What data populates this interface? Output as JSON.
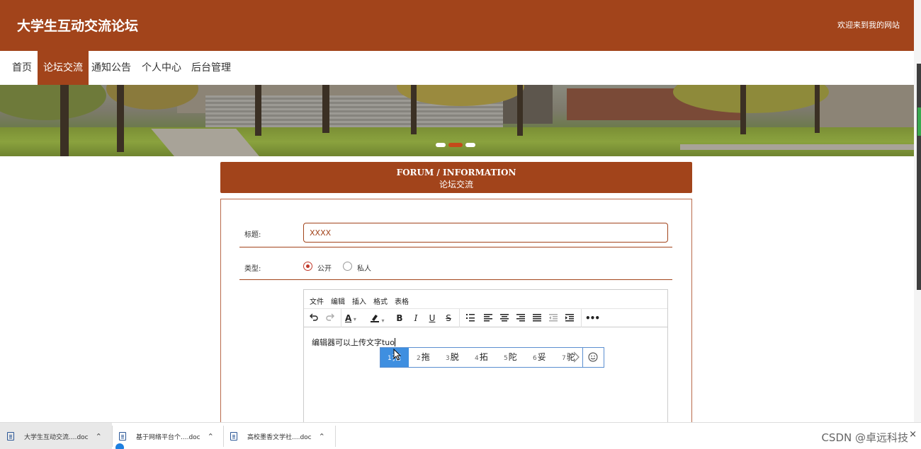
{
  "header": {
    "site_title": "大学生互动交流论坛",
    "welcome": "欢迎来到我的网站"
  },
  "nav": {
    "items": [
      {
        "label": "首页",
        "active": false
      },
      {
        "label": "论坛交流",
        "active": true
      },
      {
        "label": "通知公告",
        "active": false
      },
      {
        "label": "个人中心",
        "active": false
      },
      {
        "label": "后台管理",
        "active": false
      }
    ]
  },
  "banner": {
    "slide_count": 3,
    "active_slide": 2
  },
  "section": {
    "title_en": "FORUM / INFORMATION",
    "title_cn": "论坛交流"
  },
  "form": {
    "title_label": "标题:",
    "title_value": "XXXX",
    "type_label": "类型:",
    "type_options": [
      {
        "label": "公开",
        "checked": true
      },
      {
        "label": "私人",
        "checked": false
      }
    ]
  },
  "editor": {
    "menus": [
      "文件",
      "编辑",
      "插入",
      "格式",
      "表格"
    ],
    "toolbar_icons": [
      "undo-icon",
      "redo-icon",
      "text-color-icon",
      "highlight-icon",
      "bold-icon",
      "italic-icon",
      "underline-icon",
      "strikethrough-icon",
      "numbered-list-icon",
      "align-left-icon",
      "align-center-icon",
      "align-right-icon",
      "justify-icon",
      "outdent-icon",
      "indent-icon",
      "more-icon"
    ],
    "content": "编辑器可以上传文字tuo"
  },
  "ime": {
    "candidates": [
      {
        "num": "1",
        "text": "拖",
        "selected": true
      },
      {
        "num": "2",
        "text": "拖",
        "selected": false
      },
      {
        "num": "3",
        "text": "脱",
        "selected": false
      },
      {
        "num": "4",
        "text": "拓",
        "selected": false
      },
      {
        "num": "5",
        "text": "陀",
        "selected": false
      },
      {
        "num": "6",
        "text": "妥",
        "selected": false
      },
      {
        "num": "7",
        "text": "驼",
        "selected": false
      }
    ],
    "emoji_icon": "smiley-icon",
    "next_icon": "chevron-right-icon"
  },
  "taskbar": {
    "items": [
      {
        "label": "大学生互动交流....doc",
        "active": true
      },
      {
        "label": "基于网络平台个....doc",
        "active": false
      },
      {
        "label": "高校墨香文学社....doc",
        "active": false
      }
    ],
    "watermark": "CSDN @卓远科技",
    "close_icon": "×"
  },
  "colors": {
    "brand": "#a2441b",
    "ime_selected": "#3f8fe0"
  }
}
